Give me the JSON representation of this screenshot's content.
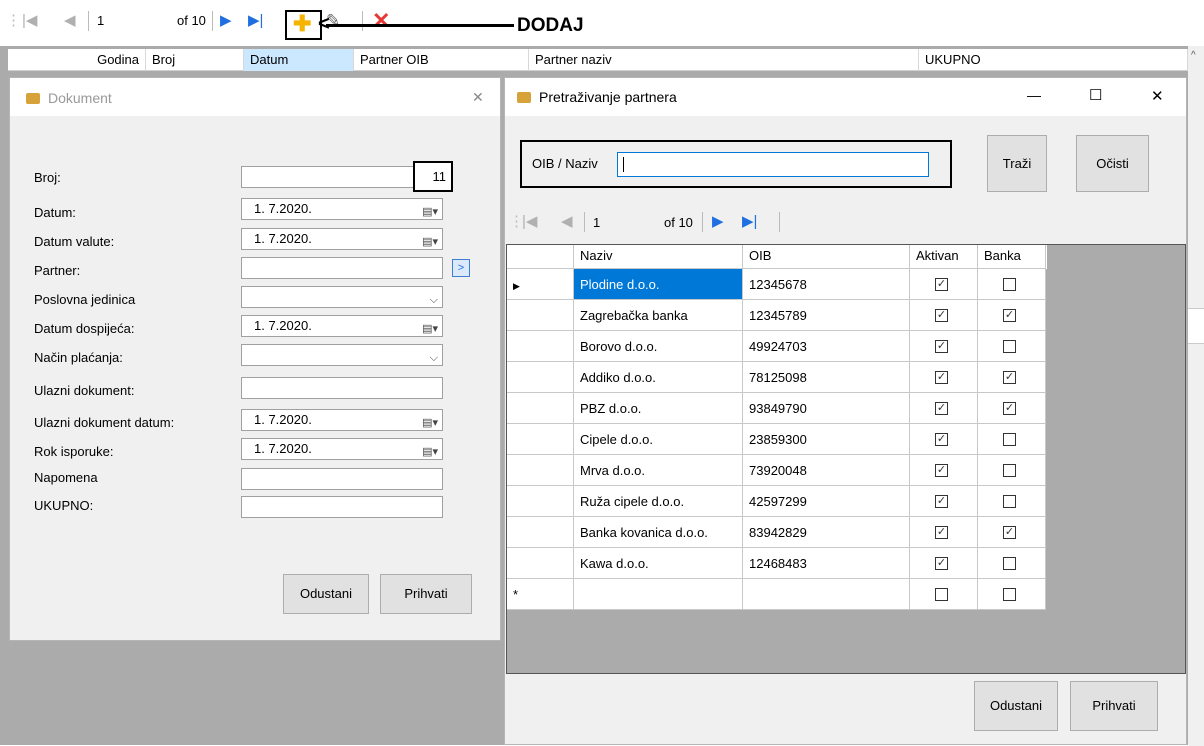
{
  "main_toolbar": {
    "position_value": "1",
    "count_text": "of 10",
    "annotation": "DODAJ"
  },
  "main_grid": {
    "columns": [
      "Godina",
      "Broj",
      "Datum",
      "Partner OIB",
      "Partner naziv",
      "UKUPNO"
    ]
  },
  "dokument_dialog": {
    "title": "Dokument",
    "close": "✕",
    "labels": {
      "broj": "Broj:",
      "datum": "Datum:",
      "datum_valute": "Datum valute:",
      "partner": "Partner:",
      "poslovna_jedinica": "Poslovna jedinica",
      "datum_dospijeca": "Datum dospijeća:",
      "nacin_placanja": "Način plaćanja:",
      "ulazni_dokument": "Ulazni dokument:",
      "ulazni_dokument_datum": "Ulazni dokument datum:",
      "rok_isporuke": "Rok isporuke:",
      "napomena": "Napomena",
      "ukupno": "UKUPNO:"
    },
    "values": {
      "broj": "11",
      "datum": "1.  7.2020.",
      "datum_valute": "1.  7.2020.",
      "datum_dospijeca": "1.  7.2020.",
      "ulazni_dokument_datum": "1.  7.2020.",
      "rok_isporuke": "1.  7.2020."
    },
    "buttons": {
      "cancel": "Odustani",
      "accept": "Prihvati"
    }
  },
  "partner_dialog": {
    "title": "Pretraživanje partnera",
    "minimize": "—",
    "maximize": "☐",
    "close": "✕",
    "search_label": "OIB / Naziv",
    "search_value": "",
    "search_button": "Traži",
    "clear_button": "Očisti",
    "nav_position": "1",
    "nav_count": "of 10",
    "columns": [
      "Naziv",
      "OIB",
      "Aktivan",
      "Banka"
    ],
    "rows": [
      {
        "naziv": "Plodine d.o.o.",
        "oib": "12345678",
        "aktivan": true,
        "banka": false
      },
      {
        "naziv": "Zagrebačka banka",
        "oib": "12345789",
        "aktivan": true,
        "banka": true
      },
      {
        "naziv": "Borovo d.o.o.",
        "oib": "49924703",
        "aktivan": true,
        "banka": false
      },
      {
        "naziv": "Addiko d.o.o.",
        "oib": "78125098",
        "aktivan": true,
        "banka": true
      },
      {
        "naziv": "PBZ d.o.o.",
        "oib": "93849790",
        "aktivan": true,
        "banka": true
      },
      {
        "naziv": "Cipele d.o.o.",
        "oib": "23859300",
        "aktivan": true,
        "banka": false
      },
      {
        "naziv": "Mrva d.o.o.",
        "oib": "73920048",
        "aktivan": true,
        "banka": false
      },
      {
        "naziv": "Ruža cipele d.o.o.",
        "oib": "42597299",
        "aktivan": true,
        "banka": false
      },
      {
        "naziv": "Banka kovanica d.o.o.",
        "oib": "83942829",
        "aktivan": true,
        "banka": true
      },
      {
        "naziv": "Kawa d.o.o.",
        "oib": "12468483",
        "aktivan": true,
        "banka": false
      }
    ],
    "new_row_marker": "*",
    "buttons": {
      "cancel": "Odustani",
      "accept": "Prihvati"
    }
  },
  "colors": {
    "nav_blue": "#1f6fe0",
    "selection": "#0078d7",
    "delete_red": "#e53935",
    "add_yellow": "#f4b400"
  }
}
